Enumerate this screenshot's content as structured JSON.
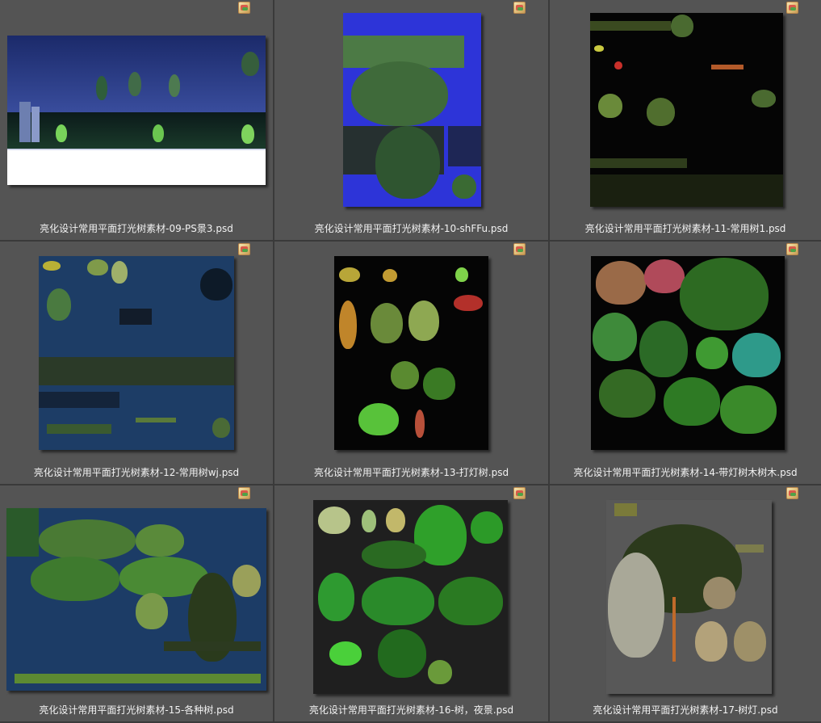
{
  "items": [
    {
      "label": "亮化设计常用平面打光树素材-09-PS景3.psd",
      "bg": "#1b2a5e"
    },
    {
      "label": "亮化设计常用平面打光树素材-10-shFFu.psd",
      "bg": "#2d34d8"
    },
    {
      "label": "亮化设计常用平面打光树素材-11-常用树1.psd",
      "bg": "#050505"
    },
    {
      "label": "亮化设计常用平面打光树素材-12-常用树wj.psd",
      "bg": "#1d3d66"
    },
    {
      "label": "亮化设计常用平面打光树素材-13-打灯树.psd",
      "bg": "#050505"
    },
    {
      "label": "亮化设计常用平面打光树素材-14-带灯树木树木.psd",
      "bg": "#050505"
    },
    {
      "label": "亮化设计常用平面打光树素材-15-各种树.psd",
      "bg": "#1c3c66"
    },
    {
      "label": "亮化设计常用平面打光树素材-16-树，夜景.psd",
      "bg": "#1f1f1f"
    },
    {
      "label": "亮化设计常用平面打光树素材-17-树灯.psd",
      "bg": "#585858"
    }
  ]
}
